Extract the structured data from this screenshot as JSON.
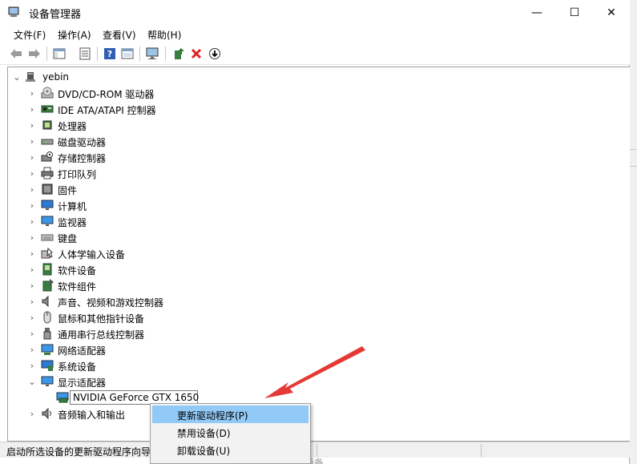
{
  "window": {
    "title": "设备管理器",
    "controls": {
      "minimize": "—",
      "maximize": "☐",
      "close": "✕"
    }
  },
  "menubar": {
    "items": [
      "文件(F)",
      "操作(A)",
      "查看(V)",
      "帮助(H)"
    ]
  },
  "tree": {
    "root": "yebin",
    "categories": [
      {
        "label": "DVD/CD-ROM 驱动器",
        "icon": "dvd-drive-icon"
      },
      {
        "label": "IDE ATA/ATAPI 控制器",
        "icon": "ide-controller-icon"
      },
      {
        "label": "处理器",
        "icon": "processor-icon"
      },
      {
        "label": "磁盘驱动器",
        "icon": "disk-drive-icon"
      },
      {
        "label": "存储控制器",
        "icon": "storage-controller-icon"
      },
      {
        "label": "打印队列",
        "icon": "printer-icon"
      },
      {
        "label": "固件",
        "icon": "firmware-icon"
      },
      {
        "label": "计算机",
        "icon": "computer-icon"
      },
      {
        "label": "监视器",
        "icon": "monitor-icon"
      },
      {
        "label": "键盘",
        "icon": "keyboard-icon"
      },
      {
        "label": "人体学输入设备",
        "icon": "hid-icon"
      },
      {
        "label": "软件设备",
        "icon": "software-device-icon"
      },
      {
        "label": "软件组件",
        "icon": "software-component-icon"
      },
      {
        "label": "声音、视频和游戏控制器",
        "icon": "speaker-icon"
      },
      {
        "label": "鼠标和其他指针设备",
        "icon": "mouse-icon"
      },
      {
        "label": "通用串行总线控制器",
        "icon": "usb-icon"
      },
      {
        "label": "网络适配器",
        "icon": "network-adapter-icon"
      },
      {
        "label": "系统设备",
        "icon": "system-device-icon"
      },
      {
        "label": "显示适配器",
        "icon": "display-adapter-icon"
      }
    ],
    "expanded_child": "NVIDIA GeForce GTX 1650",
    "after": {
      "label": "音频输入和输出",
      "icon": "audio-io-icon"
    }
  },
  "context_menu": {
    "items": [
      "更新驱动程序(P)",
      "禁用设备(D)",
      "卸载设备(U)"
    ]
  },
  "statusbar": {
    "text": "启动所选设备的更新驱动程序向导",
    "faded": "设备"
  },
  "colors": {
    "highlight": "#91c9f7",
    "arrow": "#e53935",
    "statusbar_bg": "#f0f0f0"
  }
}
